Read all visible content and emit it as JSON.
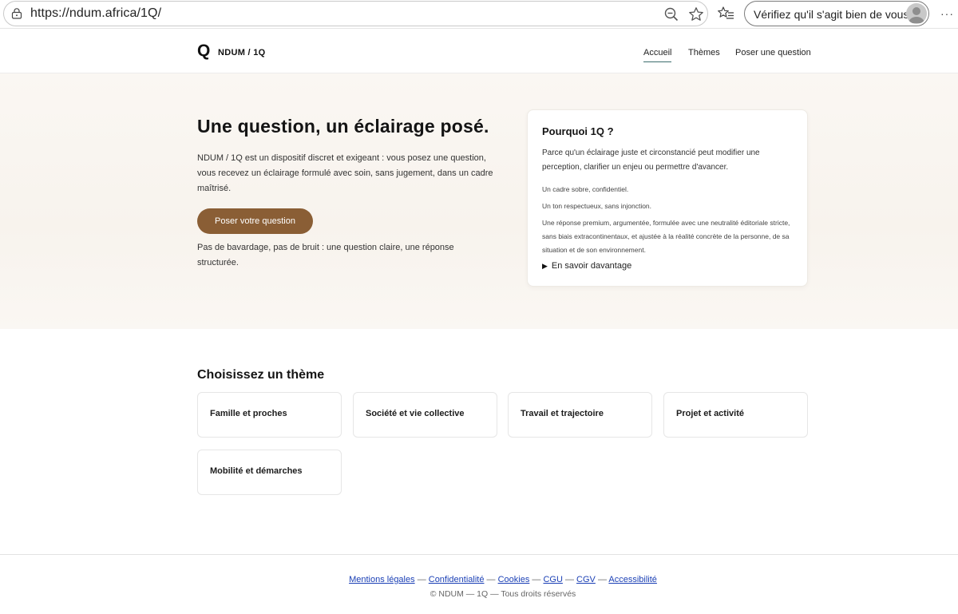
{
  "browser": {
    "url": "https://ndum.africa/1Q/",
    "verify_label": "Vérifiez qu'il s'agit bien de vous",
    "icons": [
      "lock-icon",
      "zoom-icon",
      "star-icon",
      "favorites-icon",
      "avatar",
      "more-icon"
    ]
  },
  "header": {
    "logo_mark": "Q",
    "logo_text": "NDUM / 1Q",
    "nav": [
      "Accueil",
      "Thèmes",
      "Poser une question"
    ],
    "active_nav": "Accueil",
    "accent_color": "#3c6e6e"
  },
  "hero": {
    "title": "Une question, un éclairage posé.",
    "intro": "NDUM / 1Q est un dispositif discret et exigeant : vous posez une question, vous recevez un éclairage formulé avec soin, sans jugement, dans un cadre maîtrisé.",
    "cta_label": "Poser votre question",
    "cta_color": "#8a5e35",
    "note": "Pas de bavardage, pas de bruit : une question claire, une réponse structurée."
  },
  "why": {
    "title": "Pourquoi 1Q ?",
    "lead": "Parce qu'un éclairage juste et circonstancié peut modifier une perception, clarifier un enjeu ou permettre d'avancer.",
    "points": [
      "Un cadre sobre, confidentiel.",
      "Un ton respectueux, sans injonction.",
      "Une réponse premium, argumentée, formulée avec une neutralité éditoriale stricte, sans biais extracontinentaux, et ajustée à la réalité concrète de la personne, de sa situation et de son environnement."
    ],
    "more_label": "En savoir davantage"
  },
  "themes": {
    "title": "Choisissez un thème",
    "items": [
      "Famille et proches",
      "Société et vie collective",
      "Travail et trajectoire",
      "Projet et activité",
      "Mobilité et démarches"
    ]
  },
  "footer": {
    "links": [
      "Mentions légales",
      "Confidentialité",
      "Cookies",
      "CGU",
      "CGV",
      "Accessibilité"
    ],
    "separator": "—",
    "copyright": "© NDUM — 1Q — Tous droits réservés"
  }
}
